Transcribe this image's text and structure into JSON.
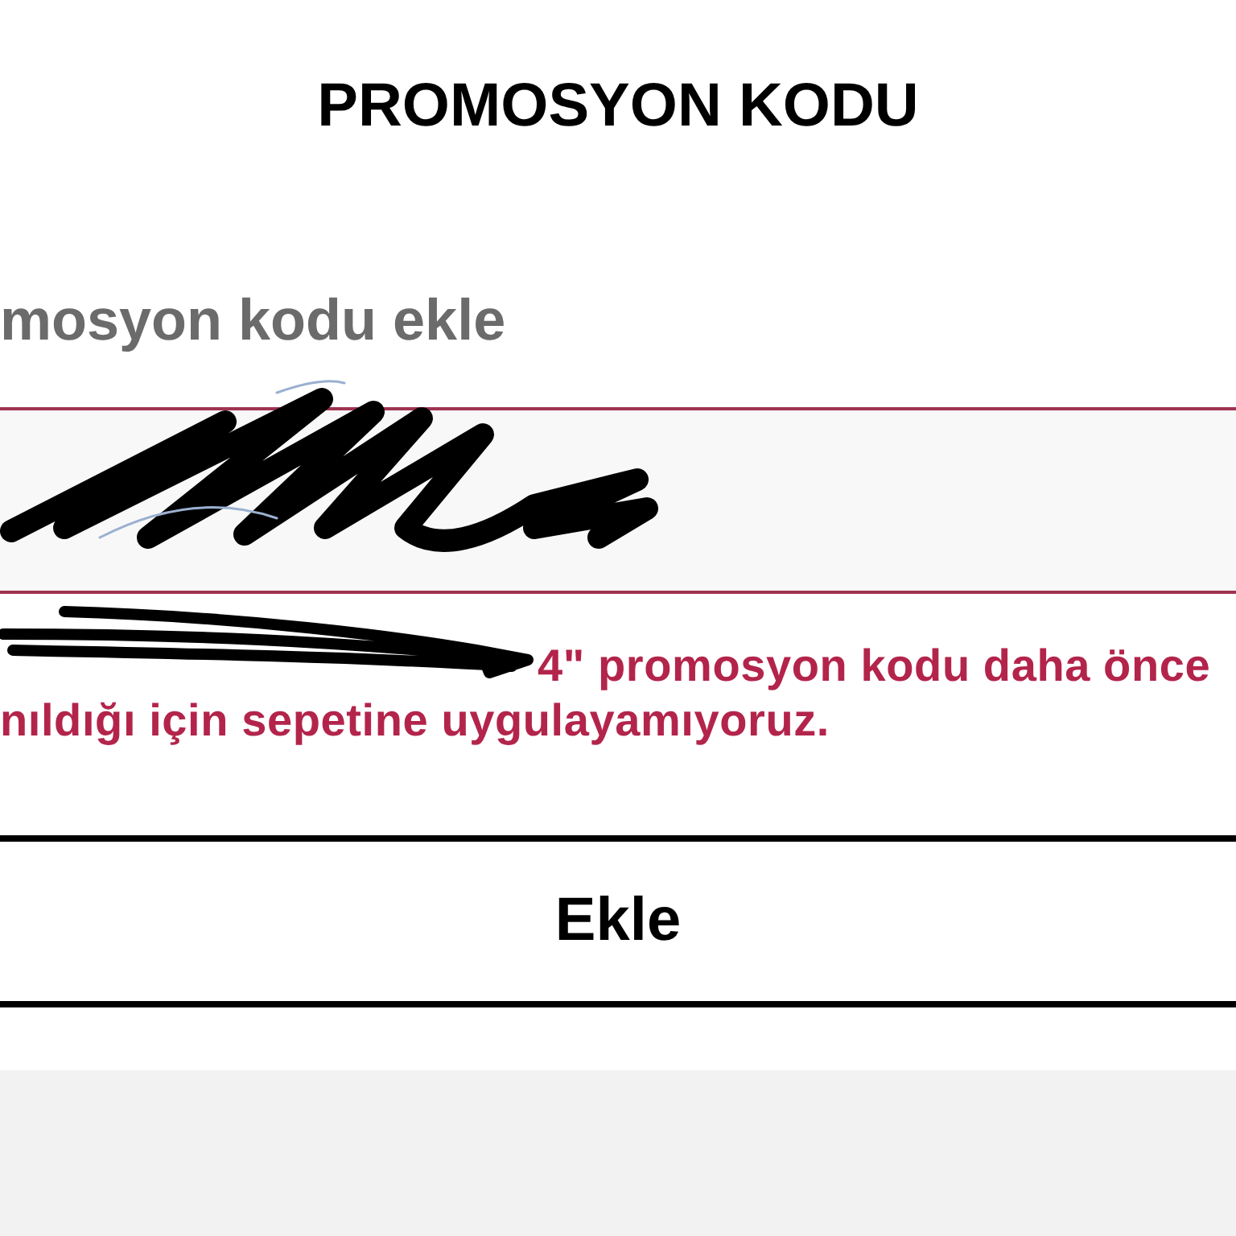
{
  "dialog": {
    "title": "PROMOSYON KODU"
  },
  "promo_code": {
    "label": "mosyon kodu ekle",
    "invalid": true,
    "error_lines": [
      "4\" promosyon kodu daha önce",
      "nıldığı için sepetine uygulayamıyoruz."
    ]
  },
  "button": {
    "label": "Ekle"
  }
}
